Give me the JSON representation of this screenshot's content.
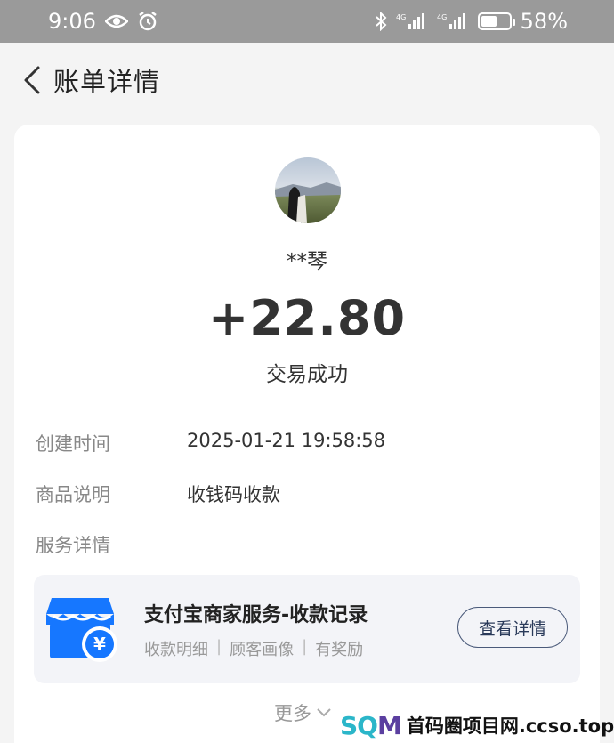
{
  "status_bar": {
    "time": "9:06",
    "battery": "58%",
    "battery_level": 0.58,
    "network_1": "4G",
    "network_2": "4G",
    "icons": [
      "eye-icon",
      "alarm-icon",
      "bluetooth-icon",
      "signal-icon",
      "signal-icon",
      "battery-icon"
    ]
  },
  "header": {
    "title": "账单详情",
    "back_icon": "chevron-left-icon"
  },
  "bill": {
    "payer_name": "**琴",
    "amount": "+22.80",
    "status": "交易成功",
    "details": [
      {
        "label": "创建时间",
        "value": "2025-01-21 19:58:58"
      },
      {
        "label": "商品说明",
        "value": "收钱码收款"
      },
      {
        "label": "服务详情",
        "value": ""
      }
    ]
  },
  "service": {
    "title": "支付宝商家服务-收款记录",
    "subs": [
      "收款明细",
      "顾客画像",
      "有奖励"
    ],
    "separator": "|",
    "view_button": "查看详情",
    "icon": "shop-yuan-icon",
    "icon_color": "#1677ff"
  },
  "more": {
    "label": "更多",
    "icon": "chevron-down-icon"
  },
  "watermark": {
    "logo_a": "SQ",
    "logo_b": "M",
    "text": "首码圈项目网.ccso.top."
  }
}
